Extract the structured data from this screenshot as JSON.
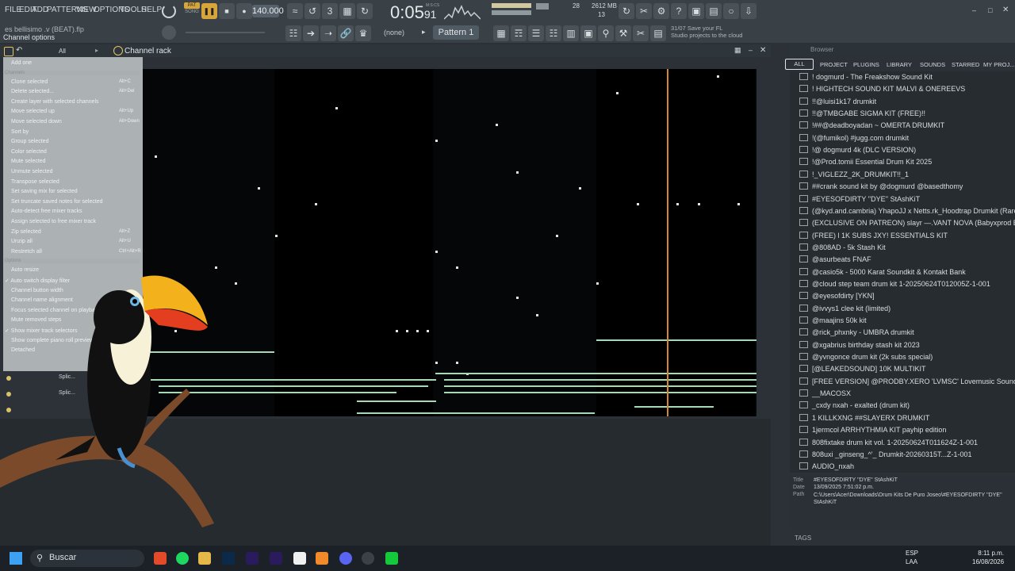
{
  "menu": [
    "FILE",
    "EDIT",
    "ADD",
    "PATTERNS",
    "VIEW",
    "OPTIONS",
    "TOOLS",
    "HELP"
  ],
  "transport": {
    "pat_song_top": "PAT",
    "pat_song_bottom": "SONG",
    "tempo": "140.000",
    "time": "0:05",
    "time_ms": "91",
    "time_label": "M:S:CS",
    "cpu": "28",
    "ram": "2612 MB",
    "voices": "13"
  },
  "project": {
    "file": "es bellisimo .v (BEAT).flp",
    "channel_options": "Channel options"
  },
  "pattern": {
    "none_label": "(none)",
    "name": "Pattern 1",
    "hint_code": "31/07",
    "hint_line1": "Save your FL",
    "hint_line2": "Studio projects to the cloud"
  },
  "channel_rack": {
    "filter": "All",
    "title": "Channel rack"
  },
  "dropdown": {
    "items": [
      {
        "label": "Add one",
        "shortcut": ""
      },
      {
        "label": "Channels",
        "header": true
      },
      {
        "label": "Clone selected",
        "shortcut": "Alt+C"
      },
      {
        "label": "Delete selected...",
        "shortcut": "Alt+Del"
      },
      {
        "label": "Create layer with selected channels",
        "shortcut": ""
      },
      {
        "label": "Move selected up",
        "shortcut": "Alt+Up"
      },
      {
        "label": "Move selected down",
        "shortcut": "Alt+Down"
      },
      {
        "label": "Sort by",
        "shortcut": ""
      },
      {
        "label": "Group selected",
        "shortcut": ""
      },
      {
        "label": "Color selected",
        "shortcut": ""
      },
      {
        "label": "Mute selected",
        "shortcut": ""
      },
      {
        "label": "Unmute selected",
        "shortcut": ""
      },
      {
        "label": "Transpose selected",
        "shortcut": ""
      },
      {
        "label": "Set saving mix for selected",
        "shortcut": ""
      },
      {
        "label": "Set truncate saved notes for selected",
        "shortcut": ""
      },
      {
        "label": "Auto-detect free mixer tracks",
        "shortcut": ""
      },
      {
        "label": "Assign selected to free mixer track",
        "shortcut": ""
      },
      {
        "label": "Zip selected",
        "shortcut": "Alt+Z"
      },
      {
        "label": "Unzip all",
        "shortcut": "Alt+U"
      },
      {
        "label": "Restretch all",
        "shortcut": "Ctrl+Alt+R"
      },
      {
        "label": "Options",
        "header": true
      },
      {
        "label": "Auto resize",
        "shortcut": ""
      },
      {
        "label": "Auto switch display filter",
        "shortcut": "",
        "checked": true
      },
      {
        "label": "Channel button width",
        "shortcut": ""
      },
      {
        "label": "Channel name alignment",
        "shortcut": ""
      },
      {
        "label": "Focus selected channel on playback",
        "shortcut": ""
      },
      {
        "label": "Mute removed steps",
        "shortcut": ""
      },
      {
        "label": "Show mixer track selectors",
        "shortcut": "",
        "checked": true
      },
      {
        "label": "Show complete piano roll preview",
        "shortcut": ""
      },
      {
        "label": "Detached",
        "shortcut": ""
      }
    ]
  },
  "rows": [
    "Splic...",
    "Splic..."
  ],
  "browser": {
    "title": "Browser",
    "tabs": [
      "ALL",
      "PROJECT",
      "PLUGINS",
      "LIBRARY",
      "SOUNDS",
      "STARRED",
      "MY PROJ..."
    ],
    "items": [
      "! dogmurd - The Freakshow Sound Kit",
      "! HIGHTECH SOUND KIT MALVI & ONEREEVS",
      "!!@luisi1k17 drumkit",
      "!!@TMBGABE SIGMA KIT (FREE)!!",
      "!##@deadboyadan ~ OMERTA DRUMKIT",
      "!(@fumikol) #jugg.com drumkit",
      "!@ dogmurd 4k (DLC VERSION)",
      "!@Prod.tomii Essential Drum Kit 2025",
      "!_VIGLEZZ_2K_DRUMKIT!!_1",
      "##crank sound kit by @dogmurd @basedthomy",
      "#EYESOFDIRTY ''DYE'' StAshKiT",
      "(@kyd.and.cambria) YhapoJJ x Netts.rk_Hoodtrap Drumkit (Rare Shit)",
      "(EXCLUSIVE ON PATREON) slayr —.VANT NOVA (Babyxprod Bangtozzy)",
      "(FREE) l 1K SUBS JXY! ESSENTIALS KIT",
      "@808AD - 5k Stash Kit",
      "@asurbeats FNAF",
      "@casio5k - 5000 Karat Soundkit & Kontakt Bank",
      "@cloud step team drum kit 1-20250624T012005Z-1-001",
      "@eyesofdirty [YKN]",
      "@ivvys1 clee kit (limited)",
      "@maajins 50k kit",
      "@rick_phxnky - UMBRA drumkit",
      "@xgabrius birthday stash kit 2023",
      "@yvngonce drum kit (2k subs special)",
      "[@LEAKEDSOUND] 10K MULTIKIT",
      "[FREE VERSION] @PRODBY.XERO 'LVMSC' Lovemusic Sound Kit",
      "__MACOSX",
      "_cxdy nxah - exalted (drum kit)",
      "1 KILLKXNG ##SLAYERX DRUMKIT",
      "1jermcol ARRHYTHMIA KIT payhip edition",
      "808fixtake drum kit vol. 1-20250624T011624Z-1-001",
      "808uxi _ginseng_^'_ Drumkit-20260315T...Z-1-001",
      "AUDIO_nxah"
    ],
    "info": {
      "title_key": "Title",
      "title_val": "#EYESOFDIRTY ''DYE'' StAshKiT",
      "date_key": "Date",
      "date_val": "13/09/2025 7:51:02 p.m.",
      "path_key": "Path",
      "path_val": "C:\\Users\\Acer\\Downloads\\Drum Kits De Puro Joseo\\#EYESOFDIRTY ''DYE'' StAshKiT"
    },
    "tags": "TAGS"
  },
  "taskbar": {
    "search": "Buscar",
    "lang1": "ESP",
    "lang2": "LAA",
    "time": "8:11 p.m.",
    "date": "16/08/2026"
  },
  "colors": {
    "accent": "#d4872e",
    "note": "#a8d8b6",
    "roll_bg": "#050607",
    "panel": "#3a4146"
  }
}
